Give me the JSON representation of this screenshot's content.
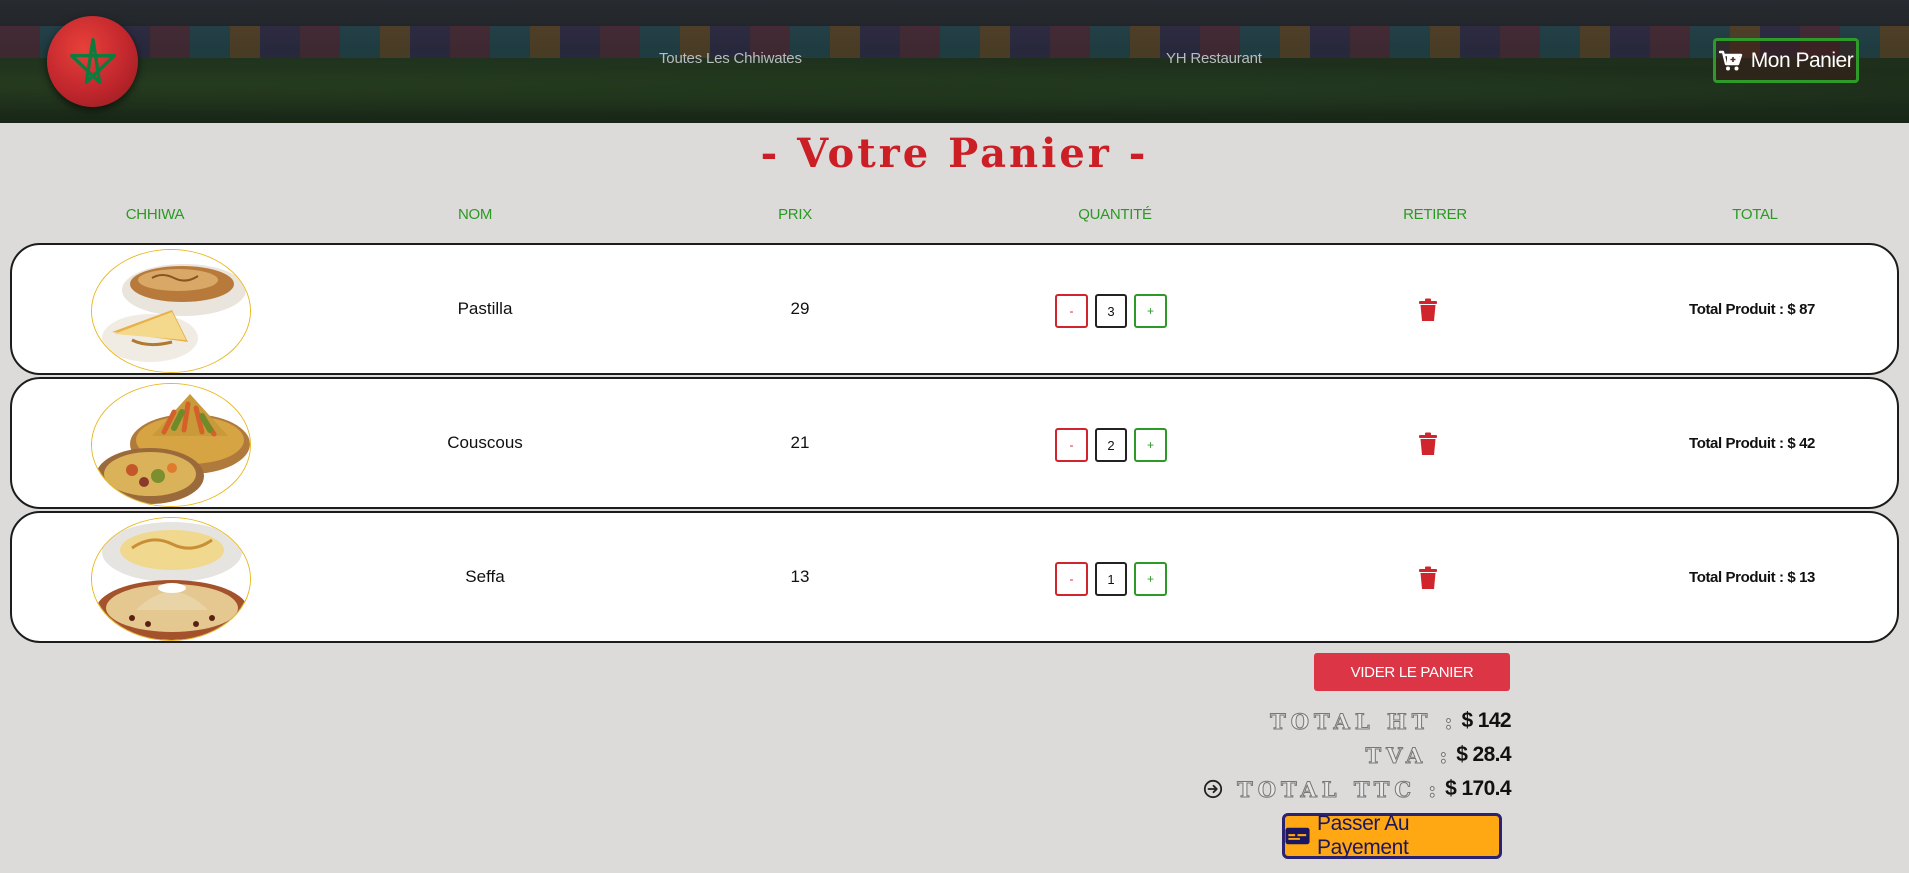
{
  "header": {
    "nav": [
      {
        "label": "Toutes Les Chhiwates"
      },
      {
        "label": "YH Restaurant"
      }
    ],
    "cart_label": "Mon Panier",
    "icons": {
      "logo": "morocco-flag-star",
      "cart": "cart-icon"
    }
  },
  "page_title": "- Votre Panier -",
  "columns": [
    "Chhiwa",
    "Nom",
    "Prix",
    "Quantité",
    "Retirer",
    "Total"
  ],
  "items": [
    {
      "name": "Pastilla",
      "price": "29",
      "qty": "3",
      "minus": "-",
      "plus": "+",
      "total": "Total Produit : $ 87"
    },
    {
      "name": "Couscous",
      "price": "21",
      "qty": "2",
      "minus": "-",
      "plus": "+",
      "total": "Total Produit : $ 42"
    },
    {
      "name": "Seffa",
      "price": "13",
      "qty": "1",
      "minus": "-",
      "plus": "+",
      "total": "Total Produit : $ 13"
    }
  ],
  "summary": {
    "empty_label": "VIDER LE PANIER",
    "ht_label": "TOTAL HT :",
    "ht_value": "$ 142",
    "tva_label": "TVA :",
    "tva_value": "$ 28.4",
    "ttc_label": "TOTAL TTC :",
    "ttc_value": "$ 170.4",
    "pay_label": "Passer Au Payement"
  },
  "colors": {
    "accent_red": "#cc1f25",
    "accent_green": "#2a9a22",
    "danger": "#dc3545",
    "pay_bg": "#ffa813",
    "pay_border": "#2a2470"
  }
}
